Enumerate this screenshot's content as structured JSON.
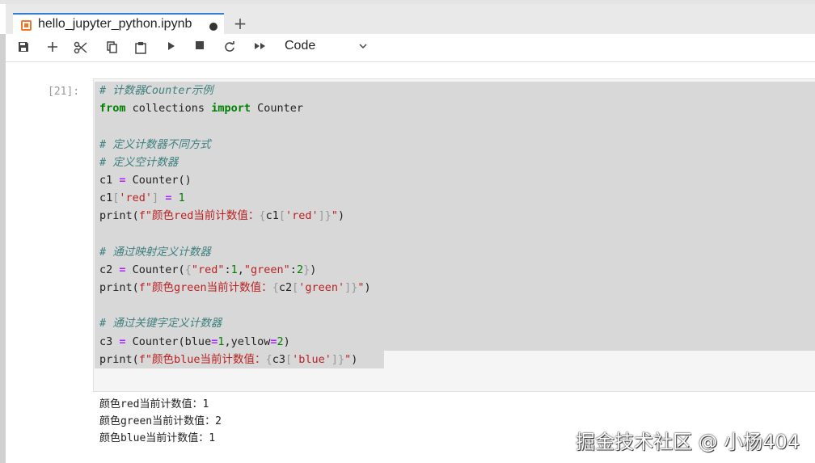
{
  "tab": {
    "title": "hello_jupyter_python.ipynb",
    "new_tab_label": "+"
  },
  "toolbar": {
    "cell_type": "Code"
  },
  "cell": {
    "prompt": "[21]:",
    "lines": [
      "<span class=\"cm\"># 计数器Counter示例</span>",
      "<span class=\"kw\">from</span> collections <span class=\"kw\">import</span> Counter",
      "",
      "<span class=\"cm\"># 定义计数器不同方式</span>",
      "<span class=\"cm\"># 定义空计数器</span>",
      "c1 <span class=\"op\">=</span> Counter()",
      "c1<span class=\"br\">[</span><span class=\"str\">'red'</span><span class=\"br\">]</span> <span class=\"op\">=</span> <span class=\"num\">1</span>",
      "print(<span class=\"str\">f\"颜色red当前计数值：</span><span class=\"br\">{</span>c1<span class=\"br\">[</span><span class=\"str\">'red'</span><span class=\"br\">]}</span><span class=\"str\">\"</span>)",
      "",
      "<span class=\"cm\"># 通过映射定义计数器</span>",
      "c2 <span class=\"op\">=</span> Counter(<span class=\"br\">{</span><span class=\"str\">\"red\"</span>:<span class=\"num\">1</span>,<span class=\"str\">\"green\"</span>:<span class=\"num\">2</span><span class=\"br\">}</span>)",
      "print(<span class=\"str\">f\"颜色green当前计数值：</span><span class=\"br\">{</span>c2<span class=\"br\">[</span><span class=\"str\">'green'</span><span class=\"br\">]}</span><span class=\"str\">\"</span>)",
      "",
      "<span class=\"cm\"># 通过关键字定义计数器</span>",
      "c3 <span class=\"op\">=</span> Counter(blue<span class=\"op\">=</span><span class=\"num\">1</span>,yellow<span class=\"op\">=</span><span class=\"num\">2</span>)",
      "print(<span class=\"str\">f\"颜色blue当前计数值：</span><span class=\"br\">{</span>c3<span class=\"br\">[</span><span class=\"str\">'blue'</span><span class=\"br\">]}</span><span class=\"str\">\"</span>)"
    ]
  },
  "output": {
    "lines": [
      "颜色red当前计数值：1",
      "颜色green当前计数值：2",
      "颜色blue当前计数值：1"
    ]
  },
  "watermark": "掘金技术社区 @ 小杨404"
}
